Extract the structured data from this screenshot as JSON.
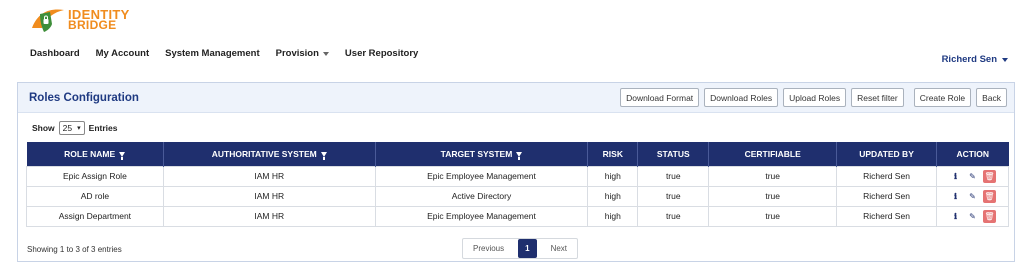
{
  "logo": {
    "line1": "IDENTITY",
    "line2": "BRIDGE"
  },
  "nav": [
    {
      "label": "Dashboard",
      "caret": false
    },
    {
      "label": "My Account",
      "caret": false
    },
    {
      "label": "System Management",
      "caret": false
    },
    {
      "label": "Provision",
      "caret": true
    },
    {
      "label": "User Repository",
      "caret": false
    }
  ],
  "user": {
    "name": "Richerd Sen"
  },
  "panel": {
    "title": "Roles Configuration",
    "buttons": [
      "Download Format",
      "Download Roles",
      "Upload Roles",
      "Reset filter",
      "Create Role",
      "Back"
    ]
  },
  "show": {
    "prefix": "Show",
    "value": "25",
    "suffix": "Entries"
  },
  "table": {
    "headers": [
      "ROLE NAME",
      "AUTHORITATIVE SYSTEM",
      "TARGET SYSTEM",
      "RISK",
      "STATUS",
      "CERTIFIABLE",
      "UPDATED BY",
      "ACTION"
    ],
    "filterable": [
      true,
      true,
      true,
      false,
      false,
      false,
      false,
      false
    ],
    "rows": [
      [
        "Epic Assign Role",
        "IAM HR",
        "Epic Employee Management",
        "high",
        "true",
        "true",
        "Richerd Sen"
      ],
      [
        "AD role",
        "IAM HR",
        "Active Directory",
        "high",
        "true",
        "true",
        "Richerd Sen"
      ],
      [
        "Assign Department",
        "IAM HR",
        "Epic Employee Management",
        "high",
        "true",
        "true",
        "Richerd Sen"
      ]
    ]
  },
  "footer": {
    "summary": "Showing 1 to 3 of 3 entries"
  },
  "pager": {
    "prev": "Previous",
    "current": "1",
    "next": "Next"
  },
  "colors": {
    "brand": "#f08c1e",
    "header": "#1f2f6e",
    "title": "#1f3a82",
    "delete": "#e57373"
  }
}
